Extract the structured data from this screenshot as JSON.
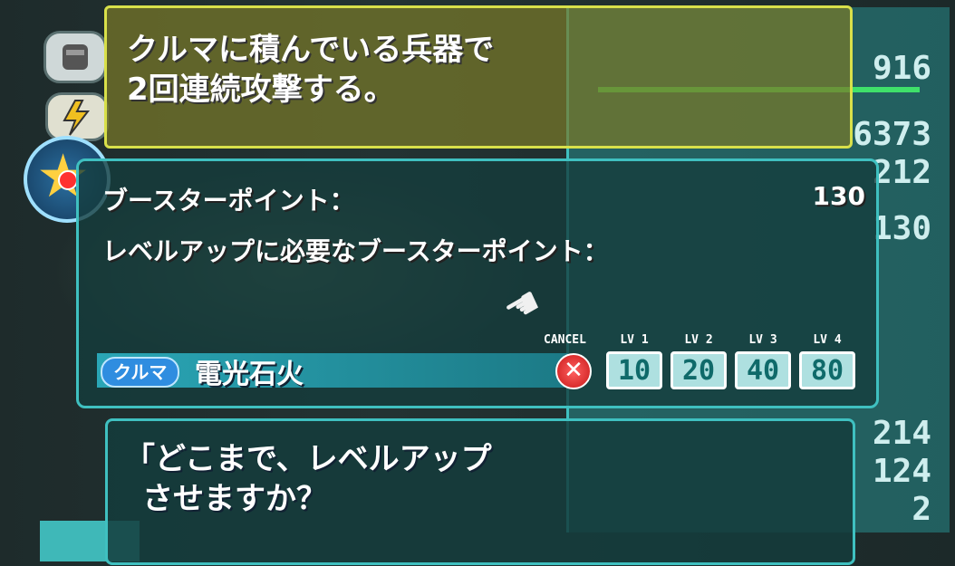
{
  "top_message": {
    "line1": "クルマに積んでいる兵器で",
    "line2": "2回連続攻撃する。"
  },
  "stats": {
    "hp_value": "916",
    "exp_value": "6373",
    "lvup_value": "212",
    "booster_value": "130",
    "value_r1": "214",
    "value_r2": "124",
    "value_r3": "2",
    "hp_fill": 1.0
  },
  "booster_dialog": {
    "label_points": "ブースターポイント：",
    "points_value": "130",
    "label_required": "レベルアップに必要なブースターポイント：",
    "category_badge": "クルマ",
    "skill_name": "電光石火",
    "cancel_label": "CANCEL",
    "cancel_symbol": "✕",
    "levels": [
      {
        "label": "LV 1",
        "value": "10"
      },
      {
        "label": "LV 2",
        "value": "20"
      },
      {
        "label": "LV 3",
        "value": "40"
      },
      {
        "label": "LV 4",
        "value": "80"
      }
    ]
  },
  "bottom_message": {
    "line1": "「どこまで、レベルアップ",
    "line2": "させますか？"
  },
  "colors": {
    "accent": "#3fc0c0",
    "top_border": "#d8e04a",
    "cancel": "#e02020",
    "hp_bar": "#3fe06a"
  },
  "icons": {
    "cursor": "pointing-hand-icon",
    "star": "star-icon",
    "helmet": "helmet-icon",
    "lightning": "lightning-icon"
  }
}
